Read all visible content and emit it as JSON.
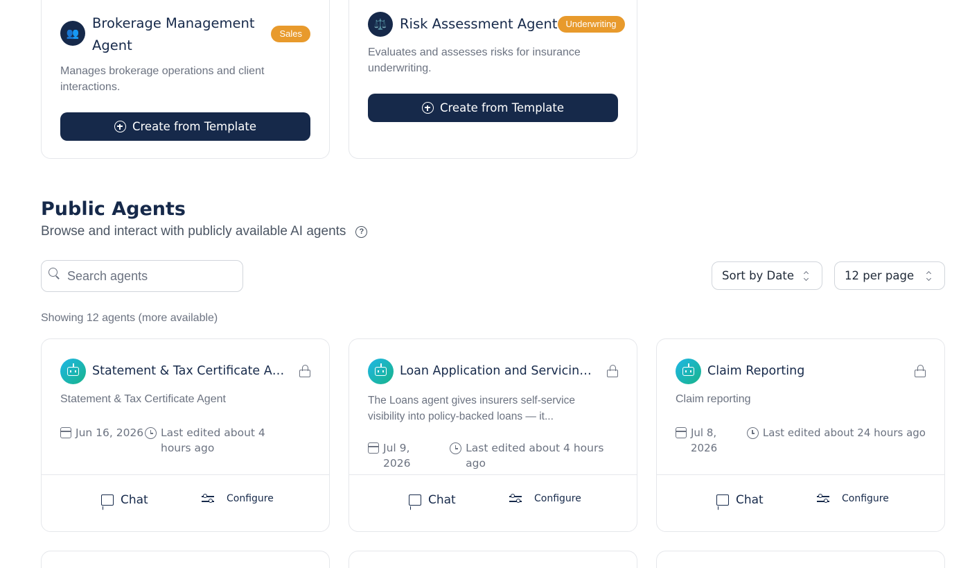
{
  "templates": [
    {
      "title": "Brokerage Management Agent",
      "badge": "Sales",
      "avatar": "👥",
      "description": "Manages brokerage operations and client interactions.",
      "button": "Create from Template"
    },
    {
      "title": "Risk Assessment Agent",
      "badge": "Underwriting",
      "avatar": "⚖️",
      "description": "Evaluates and assesses risks for insurance underwriting.",
      "button": "Create from Template"
    }
  ],
  "public": {
    "title": "Public Agents",
    "subtitle": "Browse and interact with publicly available AI agents",
    "help_icon": "?",
    "search_placeholder": "Search agents",
    "sort_value": "Sort by Date",
    "per_page_value": "12 per page",
    "showing": "Showing 12 agents (more available)"
  },
  "agents": [
    {
      "title": "Statement & Tax Certificate Agent",
      "description": "Statement & Tax Certificate Agent",
      "date": "Jun 16, 2026",
      "edited": "Last edited about 4 hours ago",
      "chat": "Chat",
      "configure": "Configure"
    },
    {
      "title": "Loan Application and Servicing Ag...",
      "description": "The Loans agent gives insurers self-service visibility into policy-backed loans — it...",
      "date": "Jul 9, 2026",
      "edited": "Last edited about 4 hours ago",
      "chat": "Chat",
      "configure": "Configure"
    },
    {
      "title": "Claim Reporting",
      "description": "Claim reporting",
      "date": "Jul 8, 2026",
      "edited": "Last edited about 24 hours ago",
      "chat": "Chat",
      "configure": "Configure"
    }
  ],
  "colors": {
    "primary": "#16294a",
    "badge": "#e89a2c",
    "muted": "#6b7280"
  }
}
